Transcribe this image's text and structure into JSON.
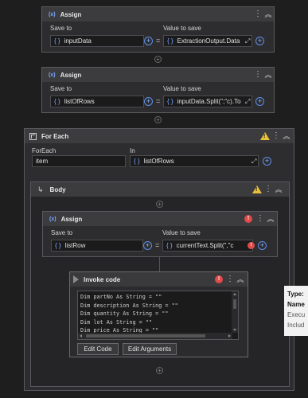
{
  "assign1": {
    "title": "Assign",
    "save_to_label": "Save to",
    "value_label": "Value to save",
    "save_to_value": "inputData",
    "value_value": "ExtractionOutput.Data"
  },
  "assign2": {
    "title": "Assign",
    "save_to_label": "Save to",
    "value_label": "Value to save",
    "save_to_value": "listOfRows",
    "value_value": "inputData.Split(\";\"c).To"
  },
  "foreach": {
    "title": "For Each",
    "foreach_label": "ForEach",
    "in_label": "In",
    "item_value": "item",
    "in_value": "listOfRows"
  },
  "body": {
    "title": "Body"
  },
  "assign3": {
    "title": "Assign",
    "save_to_label": "Save to",
    "value_label": "Value to save",
    "save_to_value": "listRow",
    "value_value": "currentText.Split(\",\"c"
  },
  "invoke": {
    "title": "Invoke code",
    "code_lines": [
      "Dim partNo As String = \"\"",
      "Dim description As String = \"\"",
      "Dim quantity As String = \"\"",
      "Dim lot As String = \"\"",
      "Dim price As String = \"\""
    ],
    "edit_code_label": "Edit Code",
    "edit_args_label": "Edit Arguments"
  },
  "tooltip": {
    "line1": "Type:",
    "line2": "Name",
    "line3": "Execu",
    "line4": "Includ"
  },
  "symbols": {
    "fx": "(x)",
    "braces": "{ }",
    "equals": "=",
    "plus": "+",
    "kebab": "⋮",
    "chevron": "︽",
    "expand": "⤢",
    "error": "!",
    "warn": "!"
  },
  "icons": [
    "assign-icon",
    "foreach-icon",
    "body-arrow-icon",
    "invoke-code-icon",
    "add-icon",
    "expand-icon",
    "error-icon",
    "warning-icon",
    "kebab-menu-icon",
    "collapse-icon"
  ]
}
